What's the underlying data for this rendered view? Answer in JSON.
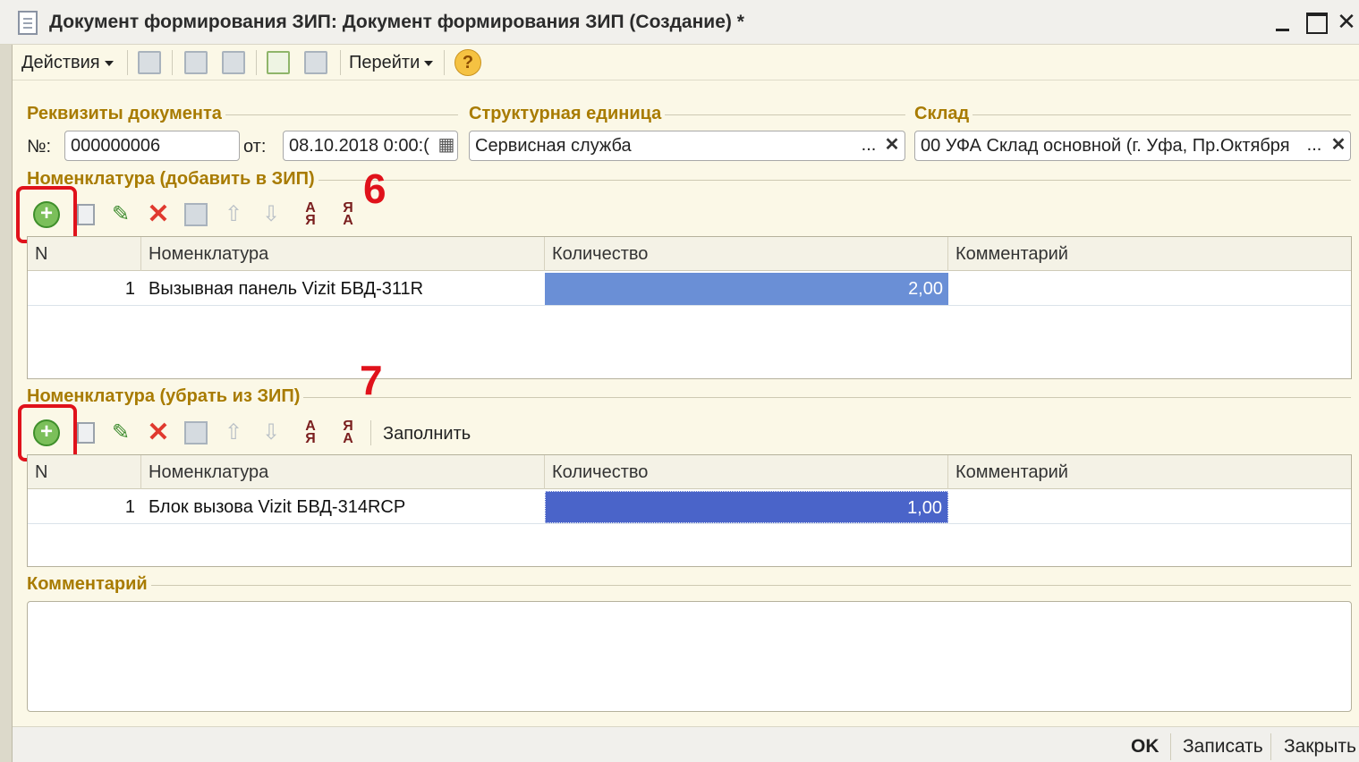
{
  "window": {
    "title": "Документ формирования ЗИП: Документ формирования ЗИП (Создание) *",
    "minimize": "",
    "maximize": "",
    "close": "✕"
  },
  "toolbar": {
    "actions_label": "Действия",
    "goto_label": "Перейти",
    "help_label": "?"
  },
  "requisites": {
    "section_title": "Реквизиты документа",
    "number_label": "№:",
    "number_value": "000000006",
    "date_label": "от:",
    "date_value": "08.10.2018  0:00:("
  },
  "structural_unit": {
    "section_title": "Структурная единица",
    "value": "Сервисная служба",
    "select": "...",
    "clear": "✕"
  },
  "warehouse": {
    "section_title": "Склад",
    "value": "00 УФА Склад основной (г. Уфа, Пр.Октября",
    "select": "...",
    "clear": "✕"
  },
  "add_section": {
    "title": "Номенклатура (добавить в ЗИП)",
    "annotation": "6",
    "columns": [
      "N",
      "Номенклатура",
      "Количество",
      "Комментарий"
    ],
    "rows": [
      {
        "n": "1",
        "item": "Вызывная панель Vizit БВД-311R",
        "qty": "2,00",
        "comment": ""
      }
    ]
  },
  "remove_section": {
    "title": "Номенклатура (убрать из ЗИП)",
    "annotation": "7",
    "fill_label": "Заполнить",
    "columns": [
      "N",
      "Номенклатура",
      "Количество",
      "Комментарий"
    ],
    "rows": [
      {
        "n": "1",
        "item": "Блок вызова Vizit БВД-314RCP",
        "qty": "1,00",
        "comment": ""
      }
    ]
  },
  "comment": {
    "section_title": "Комментарий",
    "value": ""
  },
  "footer": {
    "ok": "OK",
    "save": "Записать",
    "close": "Закрыть"
  },
  "icons": {
    "add": "+",
    "edit": "✎",
    "delete": "✕",
    "up": "⇧",
    "down": "⇩",
    "sort_asc_top": "А",
    "sort_asc_bottom": "Я",
    "sort_desc_top": "Я",
    "sort_desc_bottom": "А",
    "calendar": "▦"
  },
  "colors": {
    "header_text": "#a87b00",
    "annotation_red": "#e0121b",
    "selected_cell": "#6a8fd6",
    "selected_cell_active": "#4a64c9"
  }
}
